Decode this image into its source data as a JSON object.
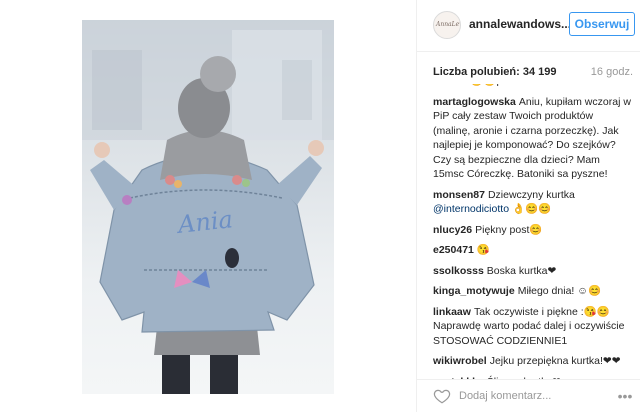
{
  "post": {
    "username": "annalewandows...",
    "follow_label": "Obserwuj",
    "likes_text": "Liczba polubień: 34 199",
    "time": "16 godz.",
    "comment_placeholder": "Dodaj komentarz..."
  },
  "photo": {
    "jacket_text": "Ania"
  },
  "comments": [
    {
      "user": "",
      "text": "kurtka? 😊😊pozdrawiam!",
      "partial": true
    },
    {
      "user": "martaglogowska",
      "text": "Aniu, kupiłam wczoraj w PiP cały zestaw Twoich produktów (malinę, aronie i czarna porzeczkę). Jak najlepiej je komponować? Do szejków? Czy są bezpieczne dla dzieci? Mam 15msc Córeczkę. Batoniki sa pyszne!"
    },
    {
      "user": "monsen87",
      "text": "Dziewczyny kurtka",
      "mention": "@internodiciotto",
      "after": " 👌😊😊"
    },
    {
      "user": "nlucy26",
      "text": "Piękny post😊"
    },
    {
      "user": "e250471",
      "text": "😘"
    },
    {
      "user": "ssolkosss",
      "text": "Boska kurtka❤"
    },
    {
      "user": "kinga_motywuje",
      "text": "Miłego dnia! ☺😊"
    },
    {
      "user": "linkaaw",
      "text": "Tak oczywiste i piękne :😘😊 Naprawdę warto podać dalej i oczywiście STOSOWAĆ CODZIENNIE1"
    },
    {
      "user": "wikiwrobel",
      "text": "Jejku przepiękna kurtka!❤❤"
    },
    {
      "user": "_antekkk_",
      "text": "Śliczna kurtka❤"
    }
  ],
  "colors": {
    "accent": "#3897f0",
    "text": "#262626",
    "muted": "#999999",
    "border": "#efefef"
  },
  "icons": {
    "like": "heart-icon",
    "more": "more-options-icon"
  }
}
